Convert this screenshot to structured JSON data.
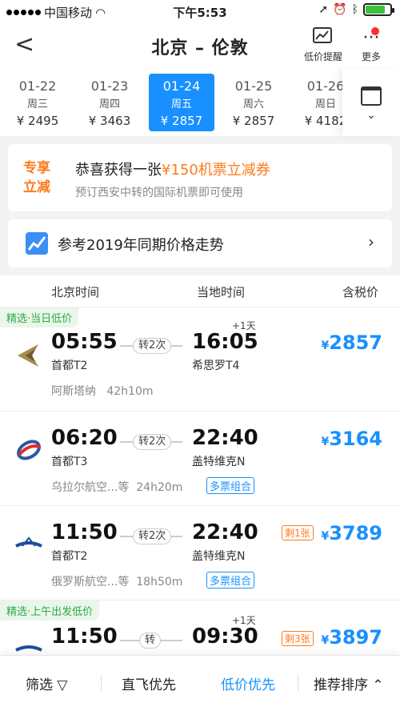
{
  "status_bar": {
    "carrier": "中国移动",
    "time": "下午5:53"
  },
  "nav": {
    "title": "北京 – 伦敦",
    "price_alert_label": "低价提醒",
    "more_label": "更多"
  },
  "dates": [
    {
      "date": "01-22",
      "weekday": "周三",
      "price": "¥ 2495",
      "selected": false
    },
    {
      "date": "01-23",
      "weekday": "周四",
      "price": "¥ 3463",
      "selected": false
    },
    {
      "date": "01-24",
      "weekday": "周五",
      "price": "¥ 2857",
      "selected": true
    },
    {
      "date": "01-25",
      "weekday": "周六",
      "price": "¥ 2857",
      "selected": false
    },
    {
      "date": "01-26",
      "weekday": "周日",
      "price": "¥ 4182",
      "selected": false
    }
  ],
  "promo": {
    "tag": "专享立减",
    "title_prefix": "恭喜获得一张",
    "title_highlight": "¥150机票立减券",
    "subtitle": "预订西安中转的国际机票即可使用"
  },
  "trend": {
    "text": "参考2019年同期价格走势"
  },
  "list_header": {
    "beijing_time": "北京时间",
    "local_time": "当地时间",
    "tax_price": "含税价"
  },
  "flights": [
    {
      "badge": "精选·当日低价",
      "dep_time": "05:55",
      "dep_terminal": "首都T2",
      "stops": "转2次",
      "next_day": "+1天",
      "arr_time": "16:05",
      "arr_terminal": "希思罗T4",
      "price": "2857",
      "currency": "¥",
      "airline": "阿斯塔纳",
      "duration": "42h10m",
      "combo": "",
      "remain": ""
    },
    {
      "badge": "",
      "dep_time": "06:20",
      "dep_terminal": "首都T3",
      "stops": "转2次",
      "next_day": "",
      "arr_time": "22:40",
      "arr_terminal": "盖特维克N",
      "price": "3164",
      "currency": "¥",
      "airline": "乌拉尔航空...等",
      "duration": "24h20m",
      "combo": "多票组合",
      "remain": ""
    },
    {
      "badge": "",
      "dep_time": "11:50",
      "dep_terminal": "首都T2",
      "stops": "转2次",
      "next_day": "",
      "arr_time": "22:40",
      "arr_terminal": "盖特维克N",
      "price": "3789",
      "currency": "¥",
      "airline": "俄罗斯航空...等",
      "duration": "18h50m",
      "combo": "多票组合",
      "remain": "剩1张"
    },
    {
      "badge": "精选·上午出发低价",
      "dep_time": "11:50",
      "dep_terminal": "",
      "stops": "转",
      "next_day": "+1天",
      "arr_time": "09:30",
      "arr_terminal": "",
      "price": "3897",
      "currency": "¥",
      "airline": "",
      "duration": "",
      "combo": "",
      "remain": "剩3张"
    }
  ],
  "bottom_bar": {
    "filter": "筛选",
    "direct_first": "直飞优先",
    "low_price_first": "低价优先",
    "recommended": "推荐排序"
  },
  "colors": {
    "accent": "#1890ff",
    "promo": "#ff7a1a",
    "badge": "#2eaa47"
  }
}
